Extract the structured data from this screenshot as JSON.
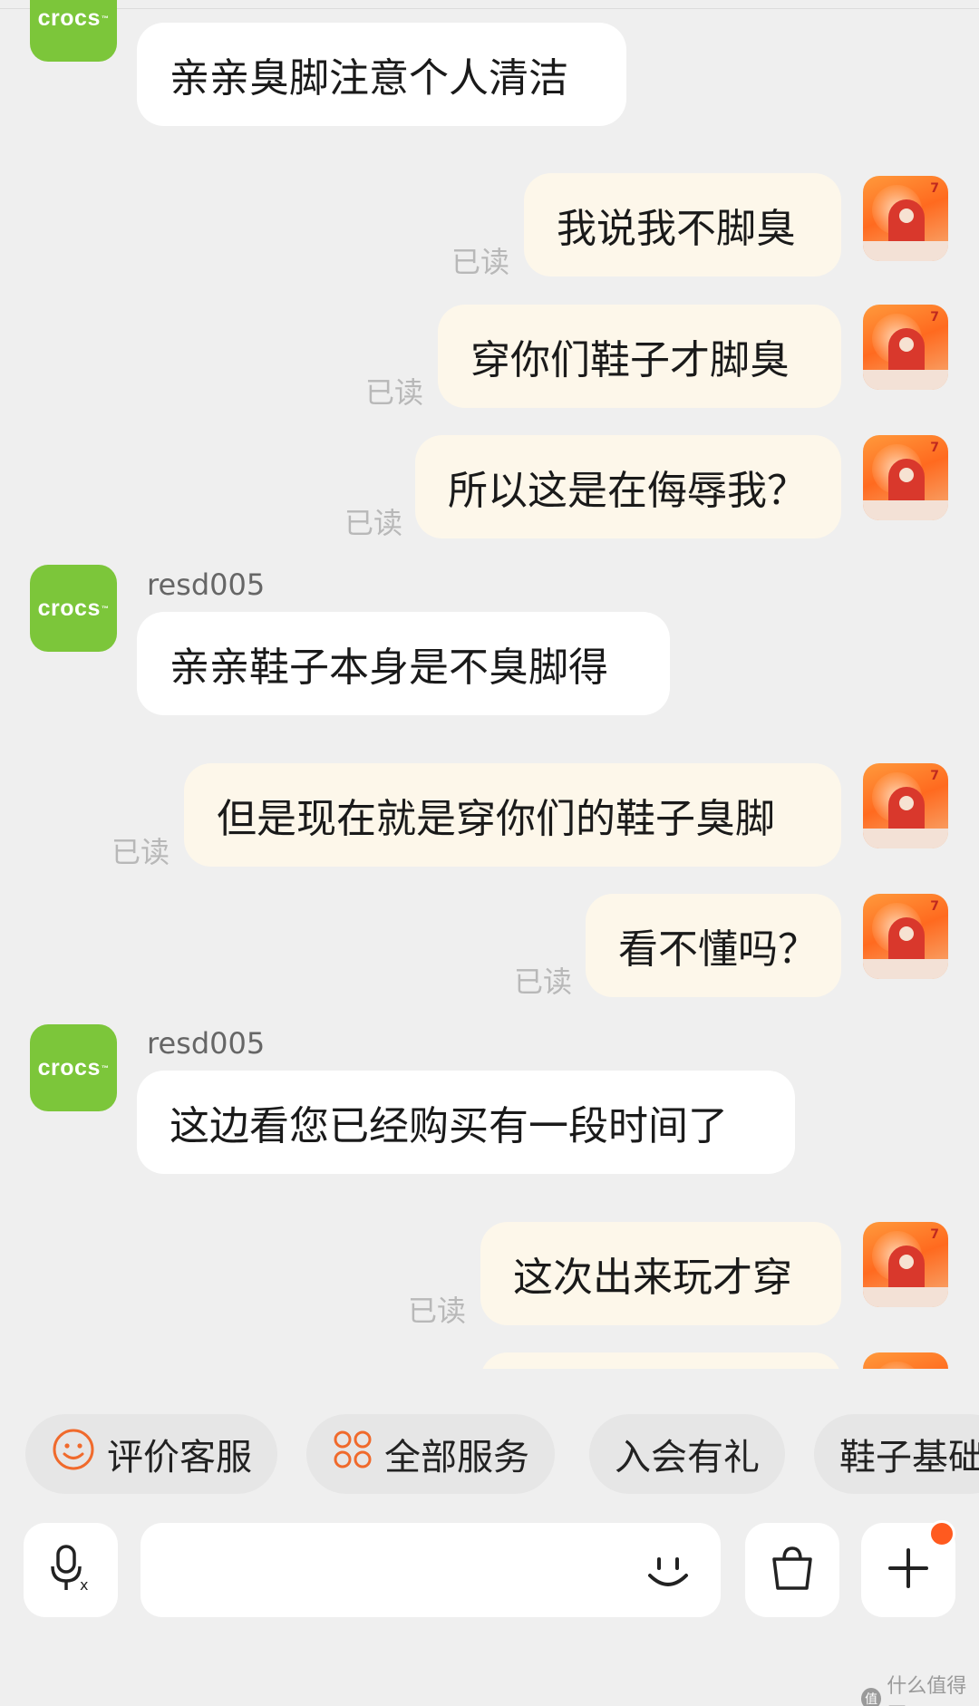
{
  "crocs_logo_text": "crocs",
  "user_avatar_num": "7",
  "read_label": "已读",
  "sender_name": "resd005",
  "messages": [
    {
      "side": "left",
      "text": "亲亲臭脚注意个人清洁"
    },
    {
      "side": "right",
      "text": "我说我不脚臭"
    },
    {
      "side": "right",
      "text": "穿你们鞋子才脚臭"
    },
    {
      "side": "right",
      "text": "所以这是在侮辱我？"
    },
    {
      "side": "left",
      "text": "亲亲鞋子本身是不臭脚得"
    },
    {
      "side": "right",
      "text": "但是现在就是穿你们的鞋子臭脚"
    },
    {
      "side": "right",
      "text": "看不懂吗？"
    },
    {
      "side": "left",
      "text": "这边看您已经购买有一段时间了"
    },
    {
      "side": "right",
      "text": "这次出来玩才穿"
    }
  ],
  "quick_actions": [
    {
      "label": "评价客服",
      "icon": "smile-icon"
    },
    {
      "label": "全部服务",
      "icon": "grid-icon"
    },
    {
      "label": "入会有礼"
    },
    {
      "label": "鞋子基础"
    }
  ],
  "input": {
    "placeholder": ""
  },
  "watermark": "什么值得买",
  "colors": {
    "crocs_green": "#7cc63a",
    "accent_orange": "#ff5a1f",
    "bubble_right": "#fdf7ea"
  }
}
